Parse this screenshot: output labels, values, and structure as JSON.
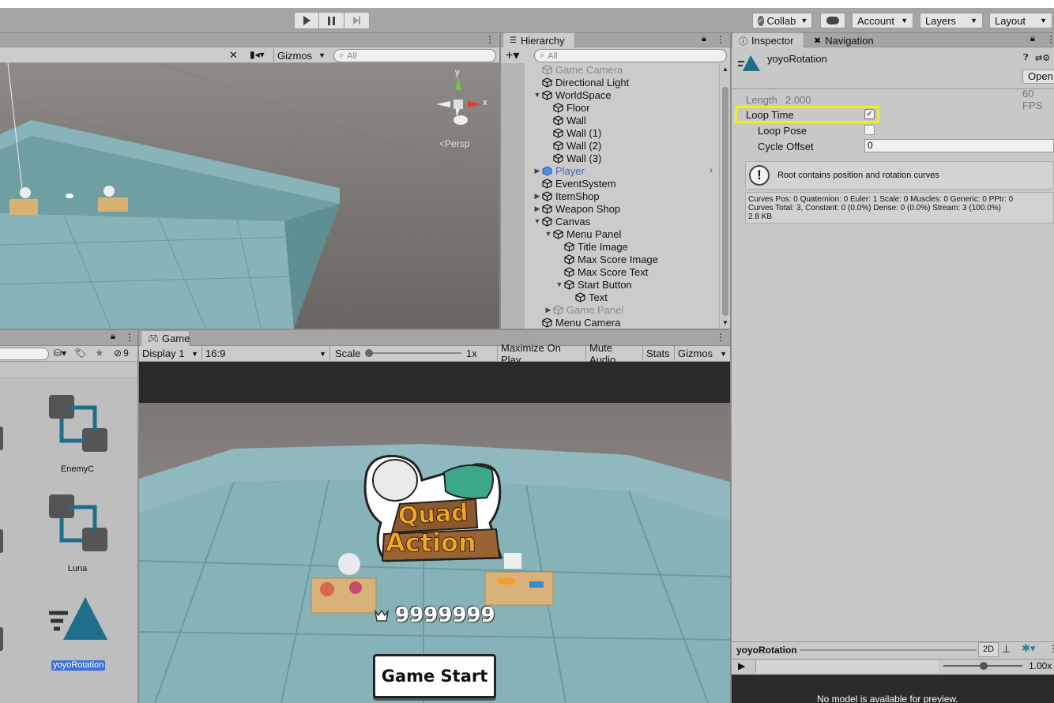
{
  "toolbar": {
    "collab_label": "Collab",
    "account_label": "Account",
    "layers_label": "Layers",
    "layout_label": "Layout"
  },
  "scene": {
    "gizmos_label": "Gizmos",
    "search_placeholder": "All",
    "persp_label": "Persp",
    "axis_y": "y",
    "axis_x": "x"
  },
  "hierarchy": {
    "tab_label": "Hierarchy",
    "search_placeholder": "All",
    "items": [
      {
        "label": "Game Camera",
        "indent": 1,
        "arrow": "",
        "style": "dim"
      },
      {
        "label": "Directional Light",
        "indent": 1,
        "arrow": "",
        "style": ""
      },
      {
        "label": "WorldSpace",
        "indent": 1,
        "arrow": "▼",
        "style": ""
      },
      {
        "label": "Floor",
        "indent": 2,
        "arrow": "",
        "style": ""
      },
      {
        "label": "Wall",
        "indent": 2,
        "arrow": "",
        "style": ""
      },
      {
        "label": "Wall (1)",
        "indent": 2,
        "arrow": "",
        "style": ""
      },
      {
        "label": "Wall (2)",
        "indent": 2,
        "arrow": "",
        "style": ""
      },
      {
        "label": "Wall (3)",
        "indent": 2,
        "arrow": "",
        "style": ""
      },
      {
        "label": "Player",
        "indent": 1,
        "arrow": "▶",
        "style": "blue"
      },
      {
        "label": "EventSystem",
        "indent": 1,
        "arrow": "",
        "style": ""
      },
      {
        "label": "ItemShop",
        "indent": 1,
        "arrow": "▶",
        "style": ""
      },
      {
        "label": "Weapon Shop",
        "indent": 1,
        "arrow": "▶",
        "style": ""
      },
      {
        "label": "Canvas",
        "indent": 1,
        "arrow": "▼",
        "style": ""
      },
      {
        "label": "Menu Panel",
        "indent": 2,
        "arrow": "▼",
        "style": ""
      },
      {
        "label": "Title Image",
        "indent": 3,
        "arrow": "",
        "style": ""
      },
      {
        "label": "Max Score Image",
        "indent": 3,
        "arrow": "",
        "style": ""
      },
      {
        "label": "Max Score Text",
        "indent": 3,
        "arrow": "",
        "style": ""
      },
      {
        "label": "Start Button",
        "indent": 3,
        "arrow": "▼",
        "style": ""
      },
      {
        "label": "Text",
        "indent": 4,
        "arrow": "",
        "style": ""
      },
      {
        "label": "Game Panel",
        "indent": 2,
        "arrow": "▶",
        "style": "dim"
      },
      {
        "label": "Menu Camera",
        "indent": 1,
        "arrow": "",
        "style": ""
      }
    ]
  },
  "inspector": {
    "tab_label": "Inspector",
    "nav_tab_label": "Navigation",
    "asset_name": "yoyoRotation",
    "open_button": "Open",
    "length_label": "Length",
    "length_value": "2.000",
    "fps_value": "60 FPS",
    "loop_time_label": "Loop Time",
    "loop_time_checked": true,
    "loop_pose_label": "Loop Pose",
    "cycle_offset_label": "Cycle Offset",
    "cycle_offset_value": "0",
    "warning_text": "Root contains position and rotation curves",
    "stats_line1": "Curves Pos: 0 Quaternion: 0 Euler: 1 Scale: 0 Muscles: 0 Generic: 0 PPtr: 0",
    "stats_line2": "Curves Total: 3, Constant: 0 (0.0%) Dense: 0 (0.0%) Stream: 3 (100.0%)",
    "stats_line3": "2.8 KB",
    "preview_title": "yoyoRotation",
    "preview_2d": "2D",
    "preview_speed": "1.00x",
    "preview_message": "No model is available for preview."
  },
  "project": {
    "hidden_count": "9",
    "items": [
      {
        "label": "EnemyC",
        "icon": "animator-controller-icon",
        "selected": false
      },
      {
        "label": "Luna",
        "icon": "animator-controller-icon",
        "selected": false
      },
      {
        "label": "yoyoRotation",
        "icon": "animation-clip-icon",
        "selected": true
      }
    ]
  },
  "game": {
    "tab_label": "Game",
    "display_label": "Display 1",
    "aspect_label": "16:9",
    "scale_label": "Scale",
    "scale_value": "1x",
    "maximize_label": "Maximize On Play",
    "mute_label": "Mute Audio",
    "stats_label": "Stats",
    "gizmos_label": "Gizmos",
    "logo_line1": "Quad",
    "logo_line2": "Action",
    "max_score": "9999999",
    "start_button_label": "Game Start"
  }
}
